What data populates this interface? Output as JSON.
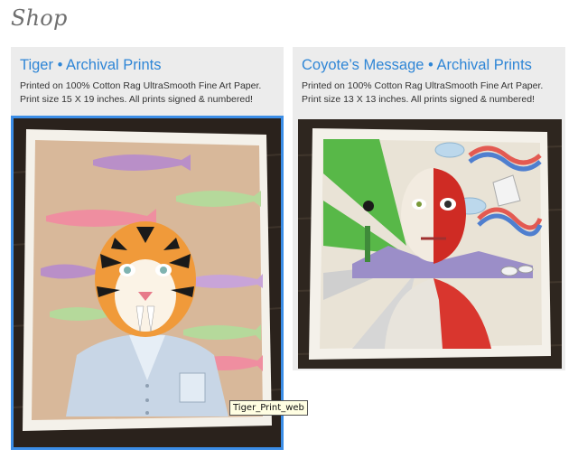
{
  "page": {
    "title": "Shop"
  },
  "products": [
    {
      "title": "Tiger • Archival Prints",
      "desc_line1": "Printed on 100% Cotton Rag UltraSmooth Fine Art Paper.",
      "desc_line2": "Print size 15 X 19 inches. All prints signed & numbered!",
      "image_alt": "Tiger_Print_web"
    },
    {
      "title": "Coyote’s Message • Archival Prints",
      "desc_line1": "Printed on 100% Cotton Rag UltraSmooth Fine Art Paper.",
      "desc_line2": "Print size 13 X 13 inches. All prints signed & numbered!",
      "image_alt": ""
    }
  ],
  "tooltip": {
    "text": "Tiger_Print_web"
  },
  "colors": {
    "link": "#2f86d6",
    "hover_border": "#3b8de6",
    "card_bg": "#ececec",
    "heading": "#6f6f6f"
  }
}
